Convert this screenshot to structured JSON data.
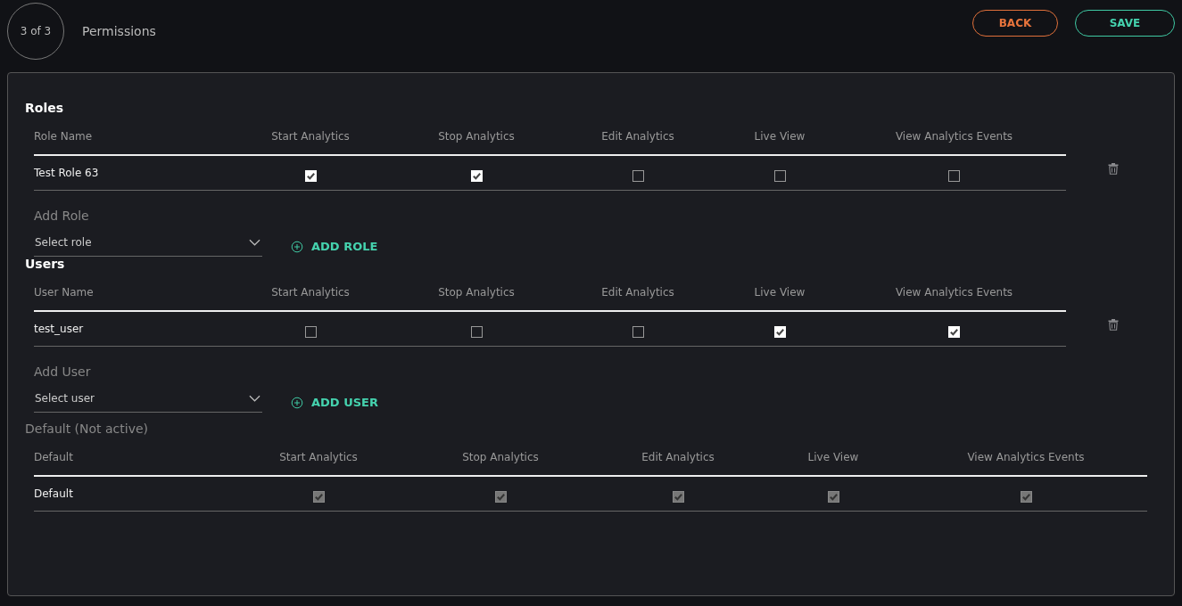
{
  "header": {
    "step": "3 of 3",
    "title": "Permissions",
    "buttons": [
      {
        "label": "BACK",
        "kind": "back"
      },
      {
        "label": "SAVE",
        "kind": "save"
      }
    ]
  },
  "sections": [
    {
      "kind": "editable",
      "title": "Roles",
      "columns": [
        "Role Name",
        "Start Analytics",
        "Stop Analytics",
        "Edit Analytics",
        "Live View",
        "View Analytics Events"
      ],
      "rows": [
        {
          "name": "Test Role 63",
          "permissions": [
            {
              "checked": true,
              "disabled": false
            },
            {
              "checked": true,
              "disabled": false
            },
            {
              "checked": false,
              "disabled": false
            },
            {
              "checked": false,
              "disabled": false
            },
            {
              "checked": false,
              "disabled": false
            }
          ]
        }
      ],
      "add": {
        "label": "Add Role",
        "placeholder": "Select role",
        "button": "ADD ROLE"
      }
    },
    {
      "kind": "editable",
      "title": "Users",
      "columns": [
        "User Name",
        "Start Analytics",
        "Stop Analytics",
        "Edit Analytics",
        "Live View",
        "View Analytics Events"
      ],
      "rows": [
        {
          "name": "test_user",
          "permissions": [
            {
              "checked": false,
              "disabled": false
            },
            {
              "checked": false,
              "disabled": false
            },
            {
              "checked": false,
              "disabled": false
            },
            {
              "checked": true,
              "disabled": false
            },
            {
              "checked": true,
              "disabled": false
            }
          ]
        }
      ],
      "add": {
        "label": "Add User",
        "placeholder": "Select user",
        "button": "ADD USER"
      }
    },
    {
      "kind": "default",
      "title": "Default (Not active)",
      "columns": [
        "Default",
        "Start Analytics",
        "Stop Analytics",
        "Edit Analytics",
        "Live View",
        "View Analytics Events"
      ],
      "rows": [
        {
          "name": "Default",
          "permissions": [
            {
              "checked": true,
              "disabled": true
            },
            {
              "checked": true,
              "disabled": true
            },
            {
              "checked": true,
              "disabled": true
            },
            {
              "checked": true,
              "disabled": true
            },
            {
              "checked": true,
              "disabled": true
            }
          ]
        }
      ]
    }
  ]
}
